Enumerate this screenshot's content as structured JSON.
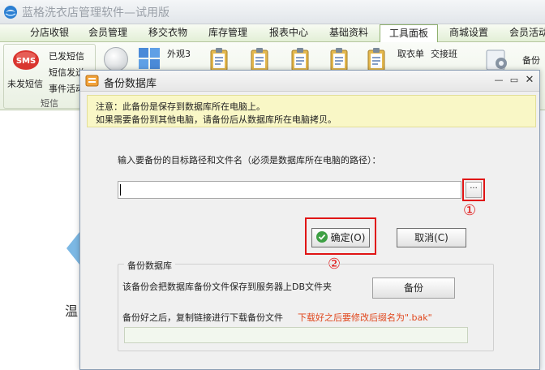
{
  "app": {
    "title": "蓝格洗衣店管理软件—试用版",
    "menu_tabs": [
      {
        "label": "分店收银",
        "active": false
      },
      {
        "label": "会员管理",
        "active": false
      },
      {
        "label": "移交衣物",
        "active": false
      },
      {
        "label": "库存管理",
        "active": false
      },
      {
        "label": "报表中心",
        "active": false
      },
      {
        "label": "基础资料",
        "active": false
      },
      {
        "label": "工具面板",
        "active": true
      },
      {
        "label": "商城设置",
        "active": false
      },
      {
        "label": "会员活动",
        "active": false
      }
    ],
    "ribbon": {
      "sms_icon_text": "SMS",
      "sms_unsent": "未发短信",
      "sms_sent": "已发短信",
      "sms_send": "短信发送...",
      "sms_event": "事件活动",
      "sms_group_label": "短信",
      "look_label": "外观3",
      "take_order_label": "取衣单",
      "shift_label": "交接班",
      "backup_label": "备份"
    },
    "left_warm": "温",
    "accent_color": "#8fb06e"
  },
  "dialog": {
    "title": "备份数据库",
    "window_controls": {
      "minimize": "—",
      "maximize": "▭",
      "close": "✕"
    },
    "notice": {
      "line1": "注意：此备份是保存到数据库所在电脑上。",
      "line2": "如果需要备份到其他电脑，请备份后从数据库所在电脑拷贝。"
    },
    "path_label": "输入要备份的目标路径和文件名（必须是数据库所在电脑的路径）：",
    "path_value": "",
    "browse_label": "···",
    "ok_label": "确定(O)",
    "cancel_label": "取消(C)",
    "marker_1": "①",
    "marker_2": "②",
    "group": {
      "title": "备份数据库",
      "description": "该备份会把数据库备份文件保存到服务器上DB文件夹",
      "backup_button": "备份",
      "download_desc": "备份好之后，复制链接进行下载备份文件",
      "download_note": "下载好之后要修改后缀名为\".bak\"",
      "download_value": ""
    },
    "highlight_color": "#e01515"
  }
}
